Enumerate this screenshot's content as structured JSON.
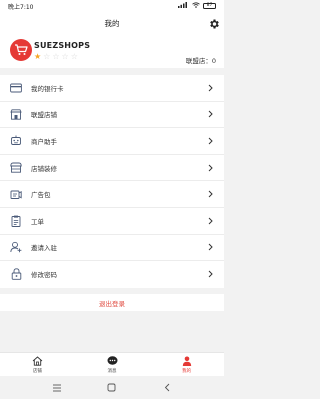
{
  "status_bar": {
    "time": "晚上7:10",
    "battery": "87"
  },
  "header": {
    "title": "我的"
  },
  "profile": {
    "shop_name": "SUEZSHOPS",
    "rating": 1,
    "max_rating": 5,
    "alliance_label": "联盟店：0"
  },
  "menu": {
    "items": [
      {
        "label": "我的银行卡",
        "icon": "bank-card-icon"
      },
      {
        "label": "联盟店铺",
        "icon": "store-icon"
      },
      {
        "label": "商户助手",
        "icon": "robot-icon"
      },
      {
        "label": "店铺装修",
        "icon": "shop-decor-icon"
      },
      {
        "label": "广告包",
        "icon": "ad-package-icon"
      },
      {
        "label": "工单",
        "icon": "clipboard-icon"
      },
      {
        "label": "邀请入驻",
        "icon": "invite-user-icon"
      },
      {
        "label": "修改密码",
        "icon": "lock-icon"
      }
    ]
  },
  "logout": {
    "label": "退出登录"
  },
  "tabbar": {
    "items": [
      {
        "label": "店铺",
        "icon": "home-icon",
        "active": false
      },
      {
        "label": "消息",
        "icon": "message-icon",
        "active": false
      },
      {
        "label": "我的",
        "icon": "person-icon",
        "active": true
      }
    ]
  },
  "colors": {
    "accent": "#e53935",
    "logout": "#e04a3f",
    "star": "#f5a623"
  }
}
